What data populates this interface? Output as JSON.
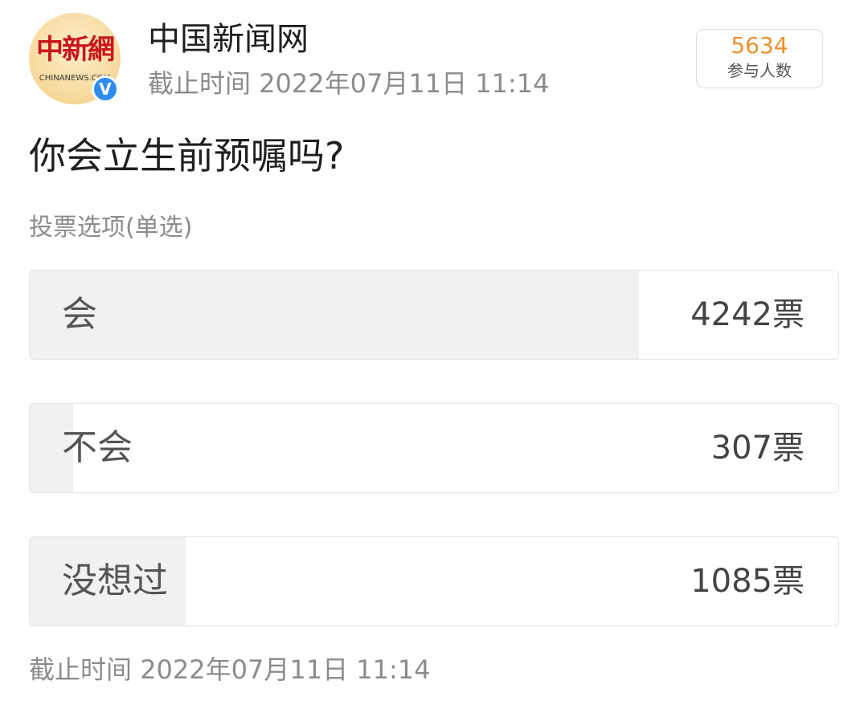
{
  "account": {
    "name": "中国新闻网",
    "logo_text": "中新網",
    "logo_subtext": "CHINANEWS.COM",
    "verified_mark": "V",
    "avatar_icon": "chinanews-logo-icon",
    "verified_icon": "verified-badge-icon"
  },
  "deadline": {
    "label": "截止时间",
    "value": "2022年07月11日 11:14"
  },
  "participants": {
    "count": "5634",
    "label": "参与人数"
  },
  "poll": {
    "question": "你会立生前预嘱吗?",
    "type_label": "投票选项(单选)",
    "options": [
      {
        "label": "会",
        "votes": "4242票",
        "vote_count": 4242,
        "fraction": 0.753
      },
      {
        "label": "不会",
        "votes": "307票",
        "vote_count": 307,
        "fraction": 0.054
      },
      {
        "label": "没想过",
        "votes": "1085票",
        "vote_count": 1085,
        "fraction": 0.193
      }
    ]
  },
  "colors": {
    "accent_count": "#e8932f",
    "bar_fill": "#f1f1f1",
    "verified_blue": "#2e8cf0",
    "logo_red": "#c8161d"
  }
}
